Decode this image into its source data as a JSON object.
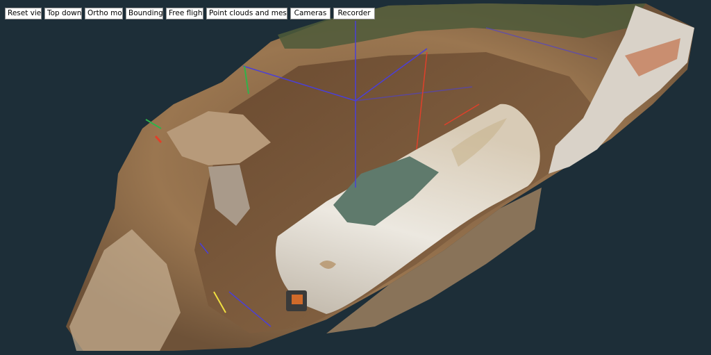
{
  "toolbar": {
    "buttons": [
      {
        "id": "reset-view",
        "label": "Reset view"
      },
      {
        "id": "top-down",
        "label": "Top down"
      },
      {
        "id": "ortho-mode",
        "label": "Ortho mode"
      },
      {
        "id": "bounding-box",
        "label": "Bounding Box"
      },
      {
        "id": "free-flight",
        "label": "Free flight"
      },
      {
        "id": "point-clouds-meshes",
        "label": "Point clouds and meshes"
      },
      {
        "id": "cameras",
        "label": "Cameras"
      },
      {
        "id": "recorder",
        "label": "Recorder"
      }
    ]
  },
  "scene": {
    "background": "#1d2e38",
    "soil_color": "#8a6a4c",
    "tank_color": "#dcd6cc",
    "tarp_color": "#5f7a6c",
    "axis_colors": {
      "x": "#e0402a",
      "y": "#2fb34a",
      "z": "#4a3fd8"
    }
  }
}
